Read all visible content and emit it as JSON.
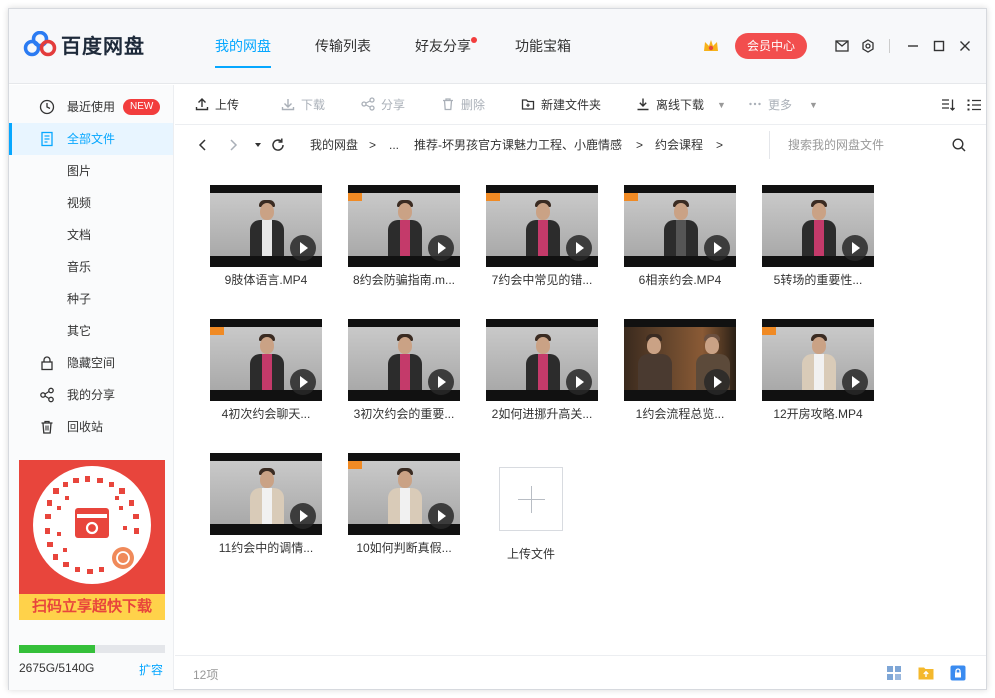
{
  "app": {
    "name": "百度网盘"
  },
  "nav": {
    "tabs": [
      "我的网盘",
      "传输列表",
      "好友分享",
      "功能宝箱"
    ],
    "active": "我的网盘"
  },
  "header": {
    "vip_label": "会员中心"
  },
  "sidebar": {
    "items": [
      {
        "label": "最近使用",
        "badge": "NEW",
        "icon": "clock-icon"
      },
      {
        "label": "全部文件",
        "icon": "document-icon",
        "active": true
      },
      {
        "label": "图片"
      },
      {
        "label": "视频"
      },
      {
        "label": "文档"
      },
      {
        "label": "音乐"
      },
      {
        "label": "种子"
      },
      {
        "label": "其它"
      },
      {
        "label": "隐藏空间",
        "icon": "lock-icon"
      },
      {
        "label": "我的分享",
        "icon": "share-icon"
      },
      {
        "label": "回收站",
        "icon": "trash-icon"
      }
    ],
    "promo_label": "扫码立享超快下载",
    "quota": {
      "used_text": "2675G/5140G",
      "fraction": 0.52,
      "expand_label": "扩容"
    }
  },
  "toolbar": {
    "upload": "上传",
    "download": "下载",
    "share": "分享",
    "delete": "删除",
    "new_folder": "新建文件夹",
    "offline": "离线下载",
    "more": "更多"
  },
  "breadcrumb": {
    "root": "我的网盘",
    "ellipsis": "...",
    "folder1": "推荐-坏男孩官方课魅力工程、小鹿情感",
    "folder2": "约会课程",
    "sep": ">"
  },
  "search": {
    "placeholder": "搜索我的网盘文件"
  },
  "files": [
    {
      "name": "9肢体语言.MP4"
    },
    {
      "name": "8约会防骗指南.m..."
    },
    {
      "name": "7约会中常见的错..."
    },
    {
      "name": "6相亲约会.MP4"
    },
    {
      "name": "5转场的重要性..."
    },
    {
      "name": "4初次约会聊天..."
    },
    {
      "name": "3初次约会的重要..."
    },
    {
      "name": "2如何进挪升高关..."
    },
    {
      "name": "1约会流程总览..."
    },
    {
      "name": "12开房攻略.MP4"
    },
    {
      "name": "11约会中的调情..."
    },
    {
      "name": "10如何判断真假..."
    }
  ],
  "upload_tile": {
    "label": "上传文件"
  },
  "status": {
    "count": "12项"
  },
  "colors": {
    "accent": "#06a7ff",
    "vip": "#f24e4e",
    "quota": "#35c03a"
  }
}
